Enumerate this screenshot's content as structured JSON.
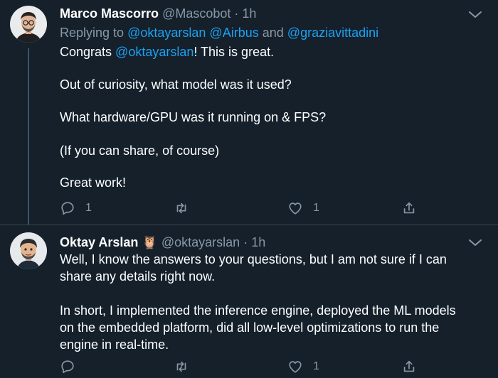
{
  "tweet1": {
    "name": "Marco Mascorro",
    "handle": "@Mascobot",
    "separator": "·",
    "time": "1h",
    "replying_prefix": "Replying to",
    "replying_mentions": [
      "@oktayarslan",
      "@Airbus",
      "@graziavittadini"
    ],
    "replying_and": "and",
    "line1_prefix": "Congrats ",
    "line1_mention": "@oktayarslan",
    "line1_suffix": "! This is great.",
    "line2": "Out of curiosity, what model was it used?",
    "line3": "What hardware/GPU was it running on & FPS?",
    "line4": "(If you can share, of course)",
    "line5": "Great work!",
    "reply_count": "1",
    "retweet_count": "",
    "like_count": "1",
    "share_count": ""
  },
  "tweet2": {
    "name": "Oktay Arslan",
    "emoji": "🦉",
    "handle": "@oktayarslan",
    "separator": "·",
    "time": "1h",
    "line1": "Well, I know the answers to your questions, but I am not sure if I can",
    "line2": "share any details right now.",
    "line3": "In short, I implemented the inference engine, deployed the ML models",
    "line4": "on the embedded platform, did all low-level optimizations to run the",
    "line5": "engine in real-time.",
    "reply_count": "",
    "retweet_count": "",
    "like_count": "1",
    "share_count": ""
  },
  "colors": {
    "background": "#15202b",
    "text": "#ffffff",
    "secondary": "#8899a6",
    "link": "#1da1f2",
    "divider": "#38444d"
  },
  "icons": [
    "more-icon",
    "reply-icon",
    "retweet-icon",
    "like-icon",
    "share-icon"
  ]
}
